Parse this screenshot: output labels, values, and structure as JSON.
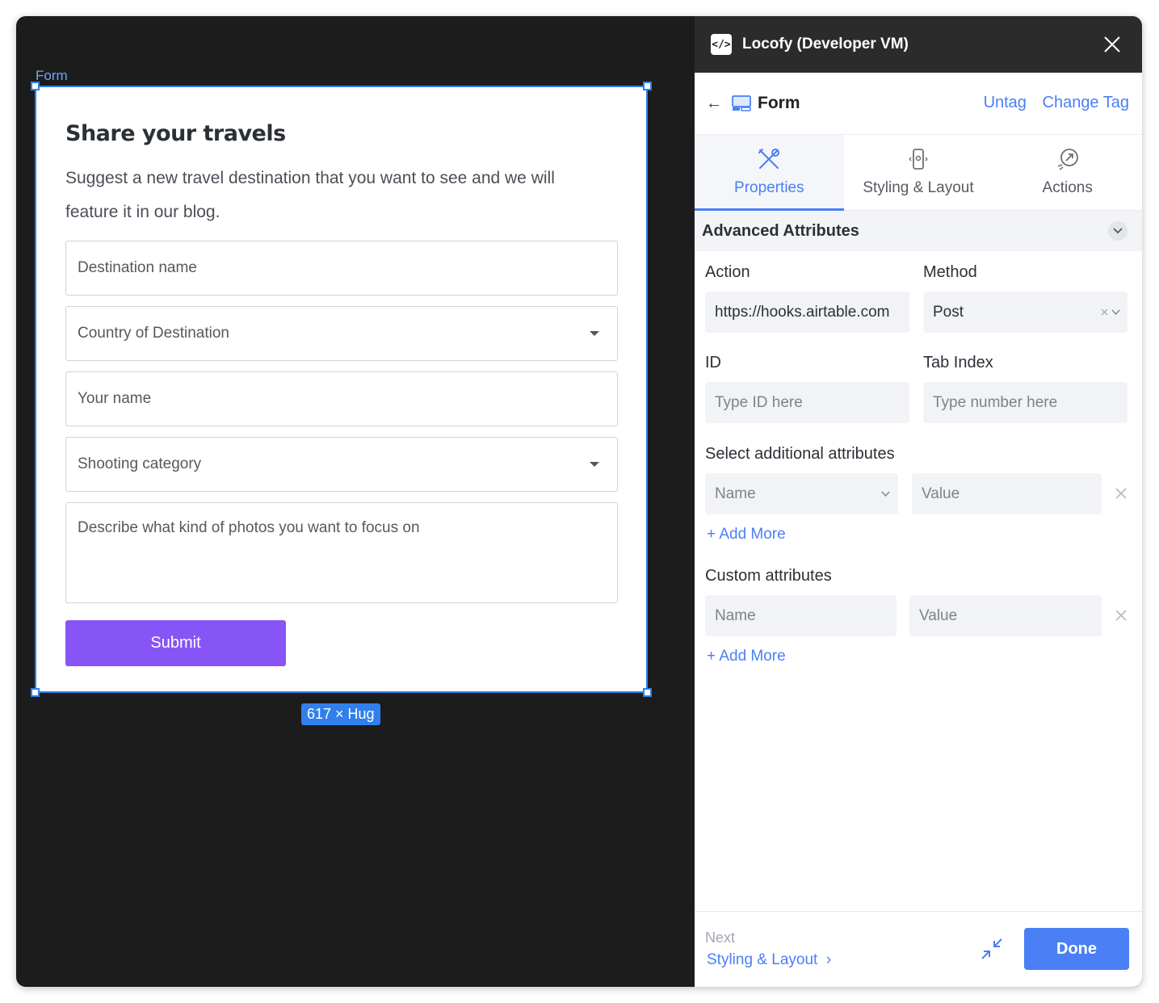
{
  "canvas": {
    "frame_label": "Form",
    "size_badge": "617 × Hug",
    "form": {
      "title": "Share your travels",
      "description": "Suggest a new travel destination that you want to see and we will feature it in our blog.",
      "fields": [
        {
          "placeholder": "Destination name",
          "type": "text"
        },
        {
          "placeholder": "Country of Destination",
          "type": "select"
        },
        {
          "placeholder": "Your name",
          "type": "text"
        },
        {
          "placeholder": "Shooting category",
          "type": "select"
        },
        {
          "placeholder": "Describe what kind of photos you want to focus on",
          "type": "textarea"
        }
      ],
      "submit_label": "Submit",
      "submit_color": "#8755f5"
    }
  },
  "panel": {
    "title": "Locofy (Developer VM)",
    "logo_glyph": "</>",
    "tag_name": "Form",
    "untag_label": "Untag",
    "change_tag_label": "Change Tag",
    "tabs": [
      {
        "label": "Properties",
        "icon": "tools-icon",
        "active": true
      },
      {
        "label": "Styling & Layout",
        "icon": "device-icon",
        "active": false
      },
      {
        "label": "Actions",
        "icon": "pointer-target-icon",
        "active": false
      }
    ],
    "section_title": "Advanced Attributes",
    "action": {
      "label": "Action",
      "value": "https://hooks.airtable.com"
    },
    "method": {
      "label": "Method",
      "value": "Post"
    },
    "id_field": {
      "label": "ID",
      "placeholder": "Type ID here"
    },
    "tab_index": {
      "label": "Tab Index",
      "placeholder": "Type number here"
    },
    "additional": {
      "label": "Select additional attributes",
      "name_placeholder": "Name",
      "value_placeholder": "Value",
      "add_more": "+ Add More"
    },
    "custom": {
      "label": "Custom attributes",
      "name_placeholder": "Name",
      "value_placeholder": "Value",
      "add_more": "+ Add More"
    },
    "footer": {
      "next_label": "Next",
      "next_link": "Styling & Layout",
      "done_label": "Done"
    },
    "accent_color": "#4a7ff5"
  }
}
